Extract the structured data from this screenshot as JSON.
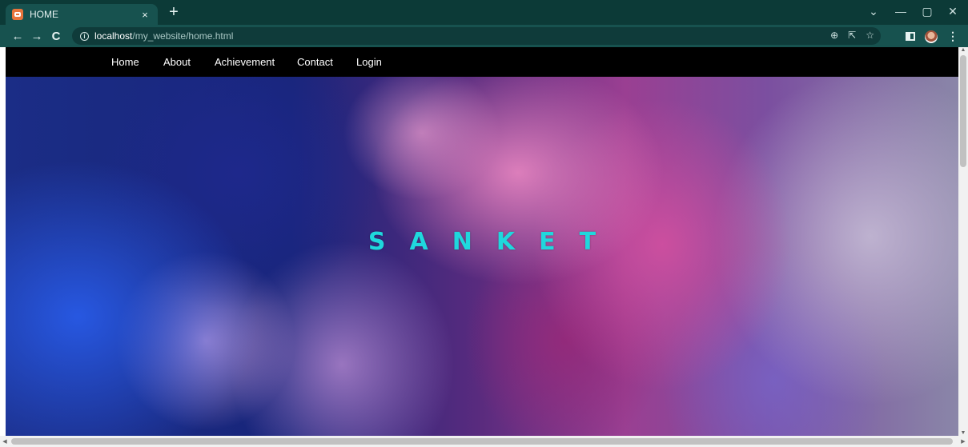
{
  "browser": {
    "tab": {
      "title": "HOME",
      "close": "×"
    },
    "new_tab": "+",
    "window_controls": {
      "minimize": "—",
      "restore": "▢",
      "close": "✕",
      "tab_search": "⌄"
    },
    "nav": {
      "back": "←",
      "forward": "→",
      "reload": "C"
    },
    "address": {
      "host": "localhost",
      "path": "/my_website/home.html",
      "info": "i"
    },
    "omnibox_icons": {
      "zoom": "⊕",
      "share": "⇱",
      "bookmark": "☆"
    },
    "menu": "⋮"
  },
  "page": {
    "nav_links": [
      "Home",
      "About",
      "Achievement",
      "Contact",
      "Login"
    ],
    "hero": {
      "title": "SANKET"
    }
  },
  "colors": {
    "browser_frame": "#17524f",
    "navbar": "#000000",
    "hero_text": "#1fd8dd"
  },
  "icons": [
    "tab-favicon-icon",
    "info-icon",
    "zoom-icon",
    "share-icon",
    "bookmark-star-icon",
    "side-panel-icon",
    "profile-avatar",
    "menu-dots-icon"
  ]
}
